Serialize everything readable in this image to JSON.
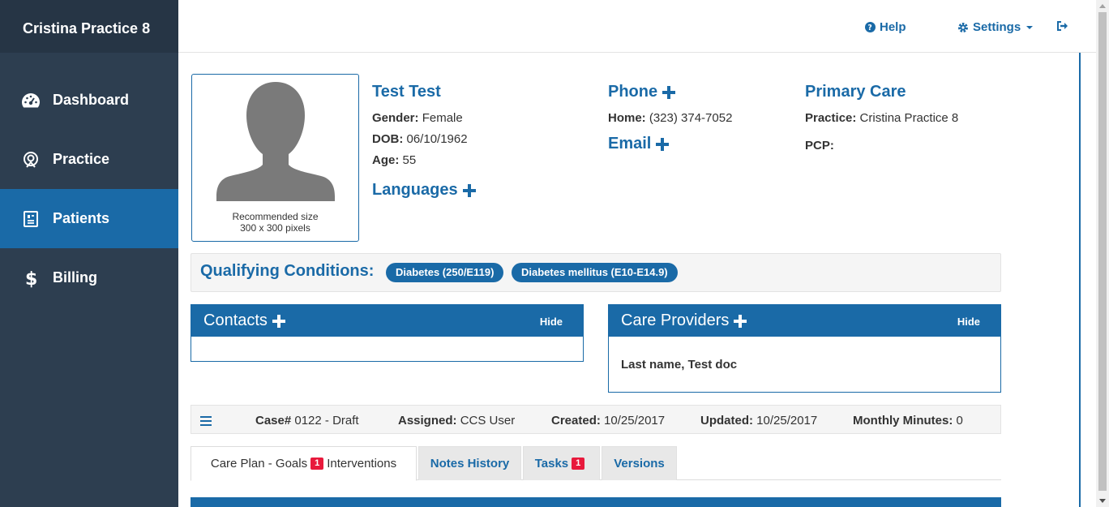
{
  "sidebar": {
    "brand": "Cristina Practice 8",
    "items": [
      {
        "label": "Dashboard",
        "icon": "dashboard-icon"
      },
      {
        "label": "Practice",
        "icon": "practice-icon"
      },
      {
        "label": "Patients",
        "icon": "patients-icon",
        "active": true
      },
      {
        "label": "Billing",
        "icon": "dollar-icon"
      }
    ]
  },
  "topbar": {
    "help_label": "Help",
    "settings_label": "Settings"
  },
  "patient": {
    "photo_caption_1": "Recommended size",
    "photo_caption_2": "300 x 300 pixels",
    "name": "Test Test",
    "gender_label": "Gender:",
    "gender": "Female",
    "dob_label": "DOB:",
    "dob": "06/10/1962",
    "age_label": "Age:",
    "age": "55",
    "languages_heading": "Languages",
    "phone_heading": "Phone",
    "home_label": "Home:",
    "home_phone": "(323) 374-7052",
    "email_heading": "Email",
    "primary_care_heading": "Primary Care",
    "practice_label": "Practice:",
    "practice": "Cristina Practice 8",
    "pcp_label": "PCP:"
  },
  "qualifying": {
    "label": "Qualifying Conditions:",
    "conditions": [
      "Diabetes (250/E119)",
      "Diabetes mellitus (E10-E14.9)"
    ]
  },
  "contacts": {
    "title": "Contacts",
    "hide_label": "Hide"
  },
  "care_providers": {
    "title": "Care Providers",
    "hide_label": "Hide",
    "entries": [
      "Last name, Test doc"
    ]
  },
  "case": {
    "case_label": "Case#",
    "case_value": "0122 - Draft",
    "assigned_label": "Assigned:",
    "assigned_value": "CCS User",
    "created_label": "Created:",
    "created_value": "10/25/2017",
    "updated_label": "Updated:",
    "updated_value": "10/25/2017",
    "minutes_label": "Monthly Minutes:",
    "minutes_value": "0"
  },
  "tabs": [
    {
      "label_before": "Care Plan - Goals",
      "badge": "1",
      "label_after": "Interventions",
      "active": true
    },
    {
      "label": "Notes History"
    },
    {
      "label": "Tasks",
      "badge": "1"
    },
    {
      "label": "Versions"
    }
  ],
  "colors": {
    "primary": "#1a6aa7",
    "sidebar": "#2d3e50",
    "badge": "#e8193c"
  }
}
